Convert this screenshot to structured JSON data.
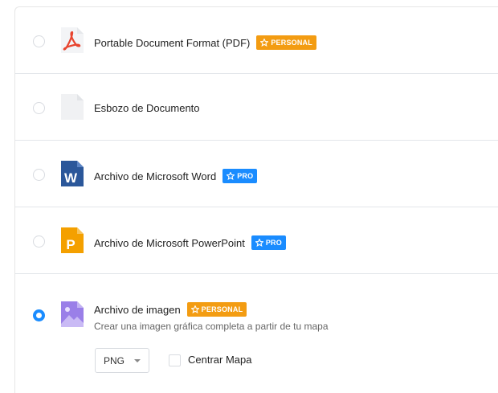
{
  "formats": [
    {
      "label": "Portable Document Format (PDF)",
      "badge": "PERSONAL",
      "icon": "pdf-icon",
      "selected": false
    },
    {
      "label": "Esbozo de Documento",
      "badge": "",
      "icon": "document-draft-icon",
      "selected": false
    },
    {
      "label": "Archivo de Microsoft Word",
      "badge": "PRO",
      "icon": "word-icon",
      "selected": false
    },
    {
      "label": "Archivo de Microsoft PowerPoint",
      "badge": "PRO",
      "icon": "powerpoint-icon",
      "selected": false
    },
    {
      "label": "Archivo de imagen",
      "badge": "PERSONAL",
      "icon": "image-icon",
      "selected": true,
      "description": "Crear una imagen gráfica completa a partir de tu mapa"
    }
  ],
  "image_options": {
    "format_value": "PNG",
    "center_map_label": "Centrar Mapa",
    "center_map_checked": false
  },
  "colors": {
    "accent": "#1a8cff",
    "personal_badge": "#f39c12",
    "pdf_red": "#e8442e",
    "word_blue": "#2b579a",
    "powerpoint_orange": "#f4a000",
    "image_purple": "#9a7fe8"
  }
}
